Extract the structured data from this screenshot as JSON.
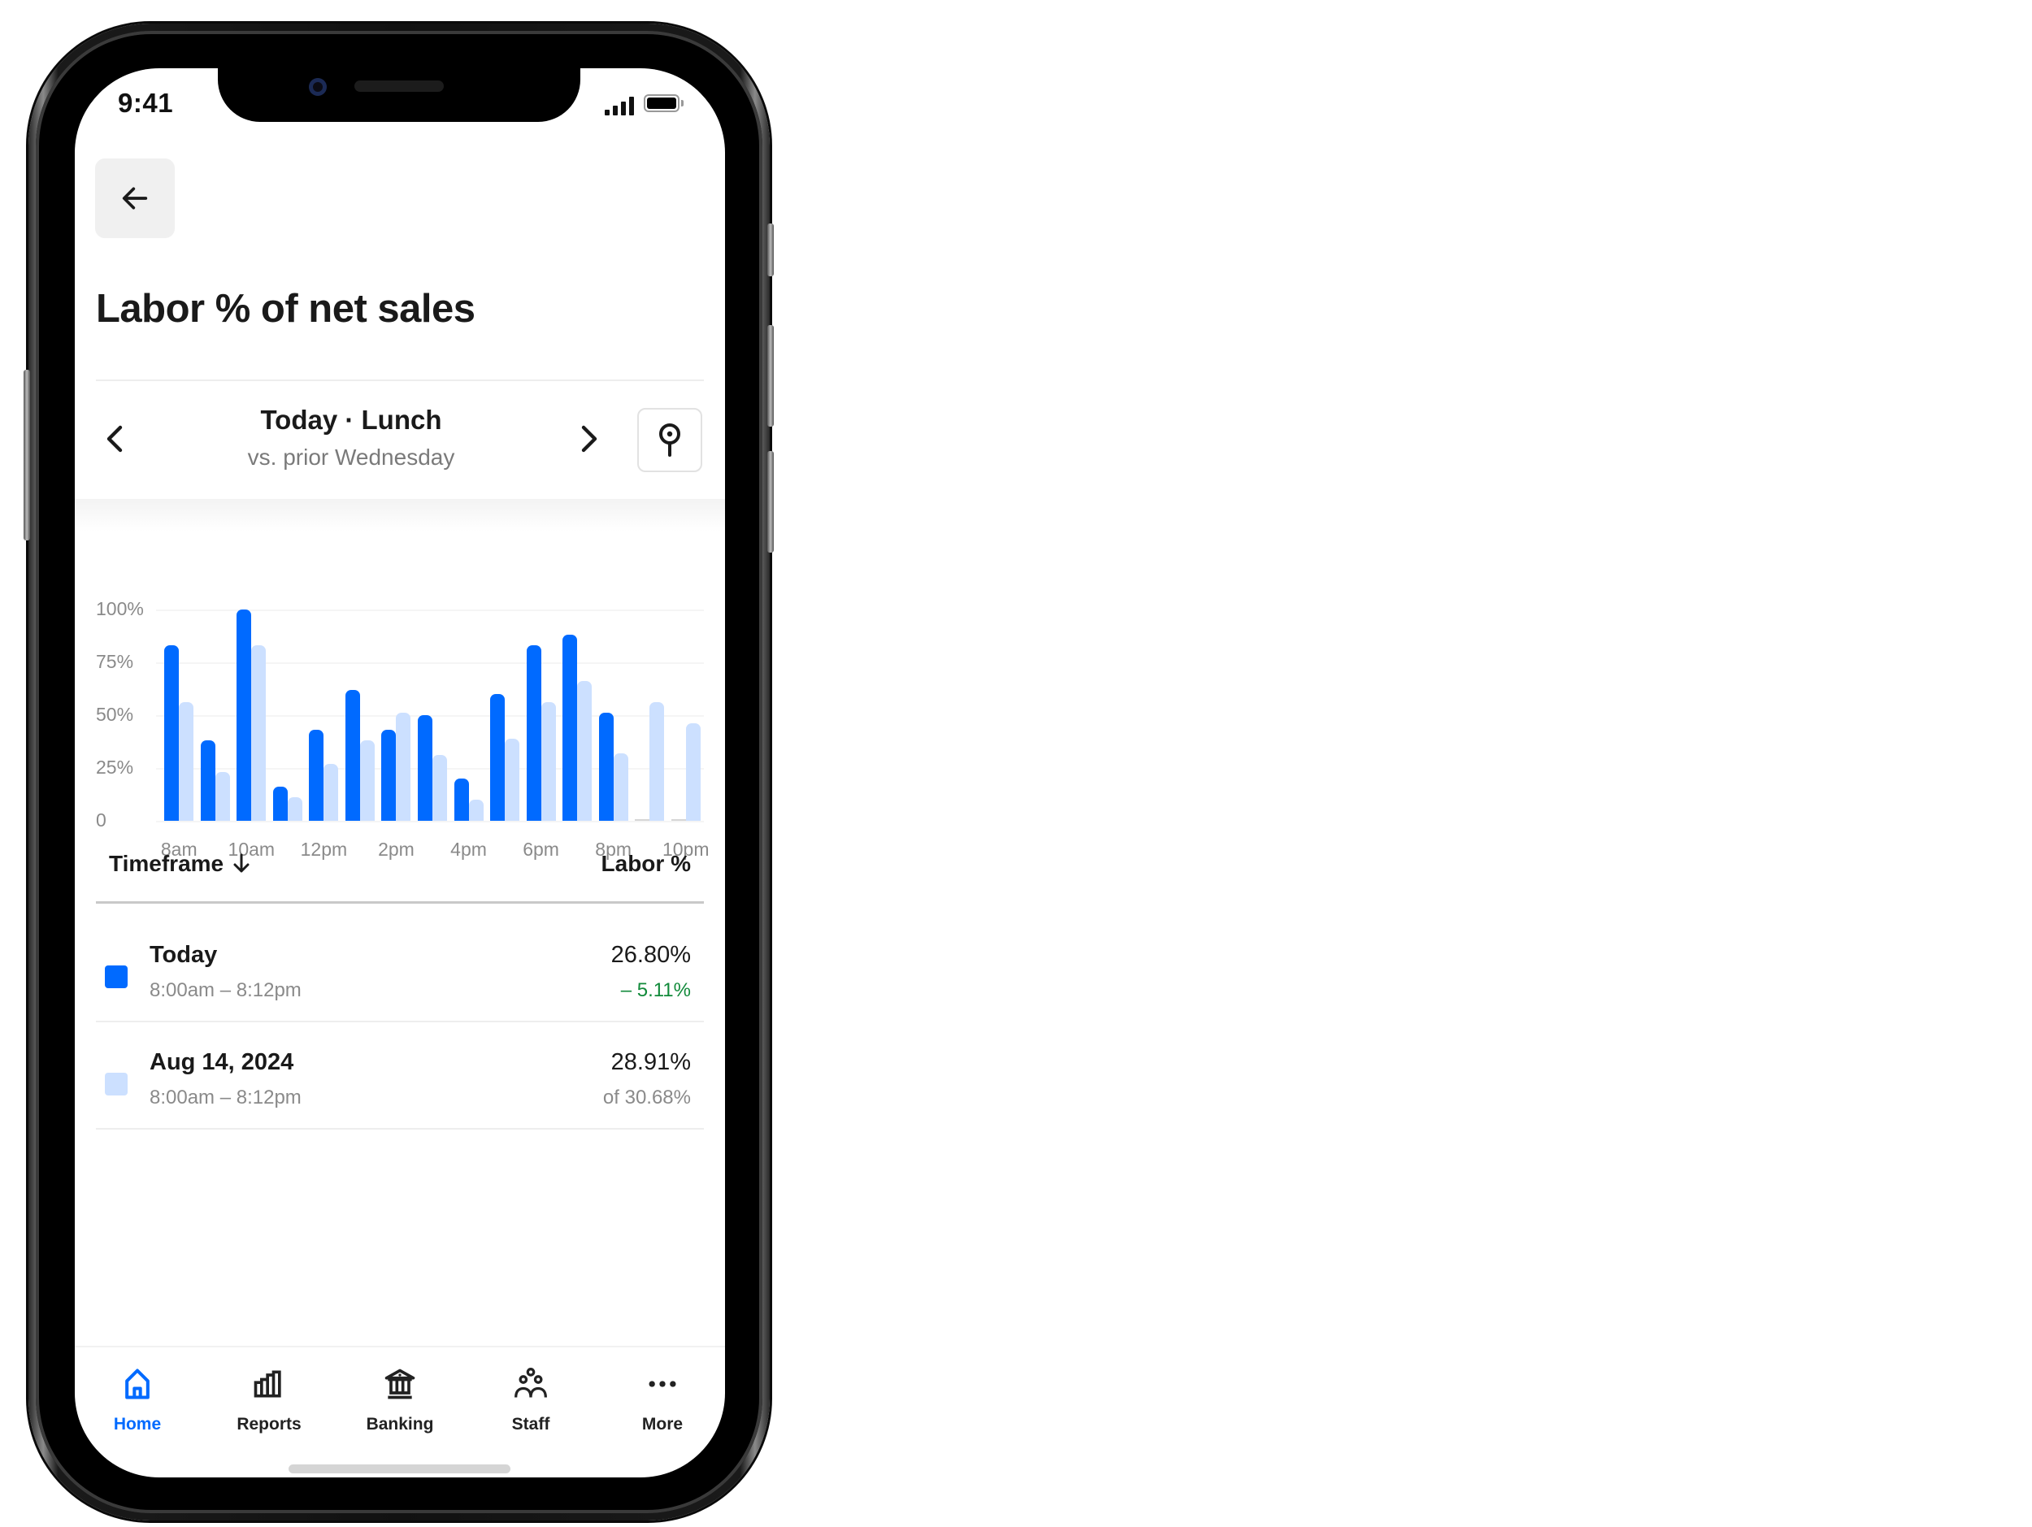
{
  "status_bar": {
    "time": "9:41",
    "signal_icon": "cellular-signal-icon",
    "battery_icon": "battery-full-icon"
  },
  "header": {
    "back_icon": "arrow-left-icon",
    "title": "Labor % of net sales"
  },
  "period_nav": {
    "prev_icon": "chevron-left-icon",
    "next_icon": "chevron-right-icon",
    "title": "Today · Lunch",
    "subtitle": "vs. prior Wednesday",
    "location_icon": "location-pin-icon"
  },
  "colors": {
    "accent": "#006aff",
    "current_series": "#006aff",
    "prior_series": "#cce0ff",
    "positive_delta": "#118a3a",
    "text_primary": "#1a1a1a",
    "text_secondary": "#8a8a8a"
  },
  "chart_data": {
    "type": "bar",
    "title": "",
    "xlabel": "",
    "ylabel": "",
    "ylim": [
      0,
      100
    ],
    "yticks": [
      "100%",
      "75%",
      "50%",
      "25%",
      "0"
    ],
    "ytick_values": [
      100,
      75,
      50,
      25,
      0
    ],
    "grid": true,
    "legend": "none",
    "categories": [
      "8am",
      "9am",
      "10am",
      "11am",
      "12pm",
      "1pm",
      "2pm",
      "3pm",
      "4pm",
      "5pm",
      "6pm",
      "7pm",
      "8pm",
      "9pm",
      "10pm"
    ],
    "xtick_labels": [
      "8am",
      "10am",
      "12pm",
      "2pm",
      "4pm",
      "6pm",
      "8pm",
      "10pm"
    ],
    "series": [
      {
        "name": "Today",
        "values": [
          83,
          38,
          100,
          16,
          43,
          62,
          43,
          50,
          20,
          60,
          83,
          88,
          51,
          0,
          0
        ]
      },
      {
        "name": "Aug 14, 2024",
        "values": [
          56,
          23,
          83,
          11,
          27,
          38,
          51,
          31,
          10,
          39,
          56,
          66,
          32,
          56,
          46
        ]
      }
    ]
  },
  "table": {
    "header_left": "Timeframe",
    "header_left_sort_icon": "arrow-down-icon",
    "header_right": "Labor %",
    "rows": [
      {
        "swatch": "current",
        "title": "Today",
        "subtitle": "8:00am – 8:12pm",
        "value": "26.80%",
        "delta": "– 5.11%"
      },
      {
        "swatch": "prior",
        "title": "Aug 14, 2024",
        "subtitle": "8:00am – 8:12pm",
        "value": "28.91%",
        "delta": "of 30.68%"
      }
    ]
  },
  "tab_bar": {
    "items": [
      {
        "label": "Home",
        "icon": "home-icon",
        "active": true
      },
      {
        "label": "Reports",
        "icon": "bar-chart-icon",
        "active": false
      },
      {
        "label": "Banking",
        "icon": "bank-icon",
        "active": false
      },
      {
        "label": "Staff",
        "icon": "staff-icon",
        "active": false
      },
      {
        "label": "More",
        "icon": "more-dots-icon",
        "active": false
      }
    ]
  }
}
